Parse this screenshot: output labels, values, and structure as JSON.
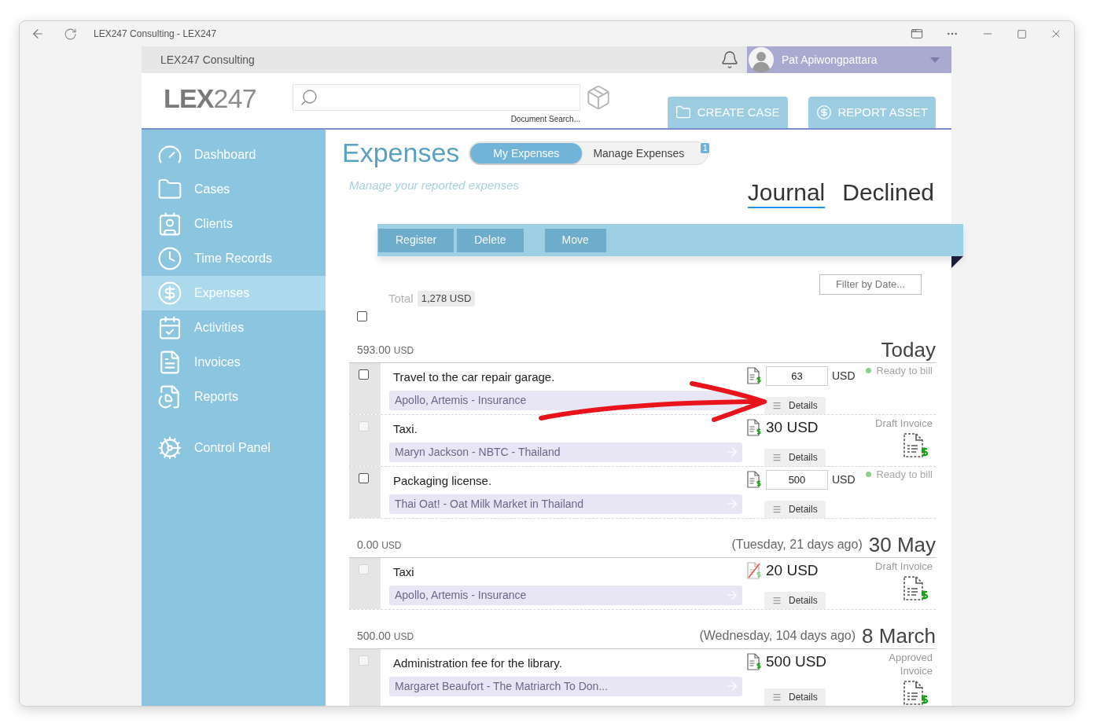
{
  "window": {
    "title": "LEX247 Consulting - LEX247"
  },
  "top_bar": {
    "firm": "LEX247 Consulting",
    "user": "Pat Apiwongpattara"
  },
  "header": {
    "logo": {
      "bold": "LEX",
      "light": "247"
    },
    "search_caption": "Document Search...",
    "buttons": [
      {
        "label": "CREATE CASE"
      },
      {
        "label": "REPORT ASSET"
      }
    ]
  },
  "sidebar": {
    "items": [
      {
        "label": "Dashboard",
        "selected": false
      },
      {
        "label": "Cases",
        "selected": false
      },
      {
        "label": "Clients",
        "selected": false
      },
      {
        "label": "Time Records",
        "selected": false
      },
      {
        "label": "Expenses",
        "selected": true
      },
      {
        "label": "Activities",
        "selected": false
      },
      {
        "label": "Invoices",
        "selected": false
      },
      {
        "label": "Reports",
        "selected": false
      }
    ],
    "bottom_items": [
      {
        "label": "Control Panel",
        "selected": false
      }
    ]
  },
  "page": {
    "title": "Expenses",
    "subtitle": "Manage your reported expenses",
    "toggle": [
      {
        "label": "My Expenses",
        "selected": true
      },
      {
        "label": "Manage Expenses",
        "selected": false,
        "badge": "1"
      }
    ],
    "tabs": [
      {
        "label": "Journal",
        "selected": true
      },
      {
        "label": "Declined",
        "selected": false
      }
    ]
  },
  "toolbar": {
    "button_groups": [
      [
        {
          "label": "Register",
          "disabled": true
        },
        {
          "label": "Delete",
          "disabled": true
        }
      ],
      [
        {
          "label": "Move",
          "disabled": true
        }
      ]
    ]
  },
  "filter_button": "Filter by Date...",
  "total": {
    "label": "Total",
    "value": "1,278 USD"
  },
  "select_all": {
    "checked": false
  },
  "groups": [
    {
      "total": "593.00",
      "currency": "USD",
      "date": "Today",
      "rows": [
        {
          "checked": false,
          "disabled": false,
          "title": "Travel to the car repair garage.",
          "client": "Apollo, Artemis - Insurance",
          "receipt_missing": false,
          "amount": {
            "kind": "input",
            "value": "63",
            "currency": "USD"
          },
          "status": {
            "kind": "ready",
            "label": "Ready to bill"
          },
          "details": "Details"
        },
        {
          "checked": false,
          "disabled": true,
          "title": "Taxi.",
          "client": "Maryn Jackson - NBTC - Thailand",
          "receipt_missing": false,
          "amount": {
            "kind": "text",
            "value": "30 USD"
          },
          "status": {
            "kind": "invoice",
            "label": "Draft Invoice"
          },
          "details": "Details"
        },
        {
          "checked": false,
          "disabled": false,
          "title": "Packaging license.",
          "client": "Thai Oat! - Oat Milk Market in Thailand",
          "receipt_missing": false,
          "amount": {
            "kind": "input",
            "value": "500",
            "currency": "USD"
          },
          "status": {
            "kind": "ready",
            "label": "Ready to bill"
          },
          "details": "Details"
        }
      ]
    },
    {
      "total": "0.00",
      "currency": "USD",
      "weekday": "(Tuesday, 21 days ago)",
      "date": "30 May",
      "rows": [
        {
          "checked": false,
          "disabled": true,
          "title": "Taxi",
          "client": "Apollo, Artemis - Insurance",
          "receipt_missing": true,
          "amount": {
            "kind": "text",
            "value": "20 USD"
          },
          "status": {
            "kind": "invoice",
            "label": "Draft Invoice"
          },
          "details": "Details"
        }
      ]
    },
    {
      "total": "500.00",
      "currency": "USD",
      "weekday": "(Wednesday, 104 days ago)",
      "date": "8 March",
      "rows": [
        {
          "checked": false,
          "disabled": true,
          "title": "Administration fee for the library.",
          "client": "Margaret Beaufort - The Matriarch To Don...",
          "receipt_missing": false,
          "amount": {
            "kind": "text",
            "value": "500 USD"
          },
          "status": {
            "kind": "invoice",
            "label": "Approved Invoice"
          },
          "details": "Details"
        }
      ]
    }
  ]
}
